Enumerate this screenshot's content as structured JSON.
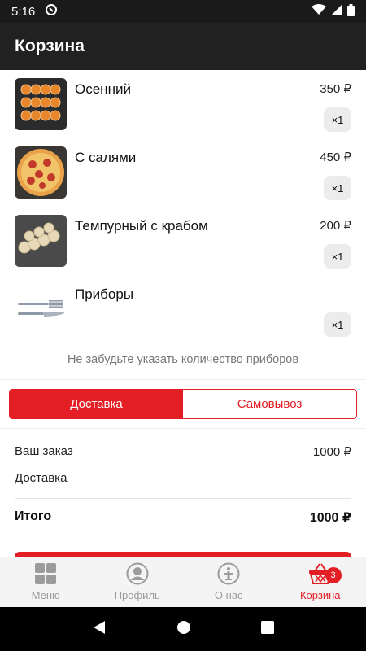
{
  "status_bar": {
    "time": "5:16"
  },
  "app_bar": {
    "title": "Корзина"
  },
  "cart_items": [
    {
      "name": "Осенний",
      "price": "350 ₽",
      "qty": "×1",
      "image": "rolls-with-caviar"
    },
    {
      "name": "С салями",
      "price": "450 ₽",
      "qty": "×1",
      "image": "salami-pizza"
    },
    {
      "name": "Темпурный с крабом",
      "price": "200 ₽",
      "qty": "×1",
      "image": "tempura-crab-rolls"
    },
    {
      "name": "Приборы",
      "price": "",
      "qty": "×1",
      "image": "fork-and-knife"
    }
  ],
  "reminder": "Не забудьте указать количество приборов",
  "delivery_toggle": {
    "delivery": "Доставка",
    "pickup": "Самовывоз",
    "selected": "delivery"
  },
  "summary": {
    "order_label": "Ваш заказ",
    "order_value": "1000 ₽",
    "delivery_label": "Доставка",
    "delivery_value": "",
    "total_label": "Итого",
    "total_value": "1000 ₽"
  },
  "bottom_nav": {
    "items": [
      {
        "label": "Меню",
        "icon": "grid-icon"
      },
      {
        "label": "Профиль",
        "icon": "profile-icon"
      },
      {
        "label": "О нас",
        "icon": "info-icon"
      },
      {
        "label": "Корзина",
        "icon": "basket-icon",
        "badge": "3",
        "active": true
      }
    ]
  },
  "colors": {
    "accent": "#e31e24",
    "app_bar": "#212121",
    "status_bar": "#1a1a1a"
  }
}
